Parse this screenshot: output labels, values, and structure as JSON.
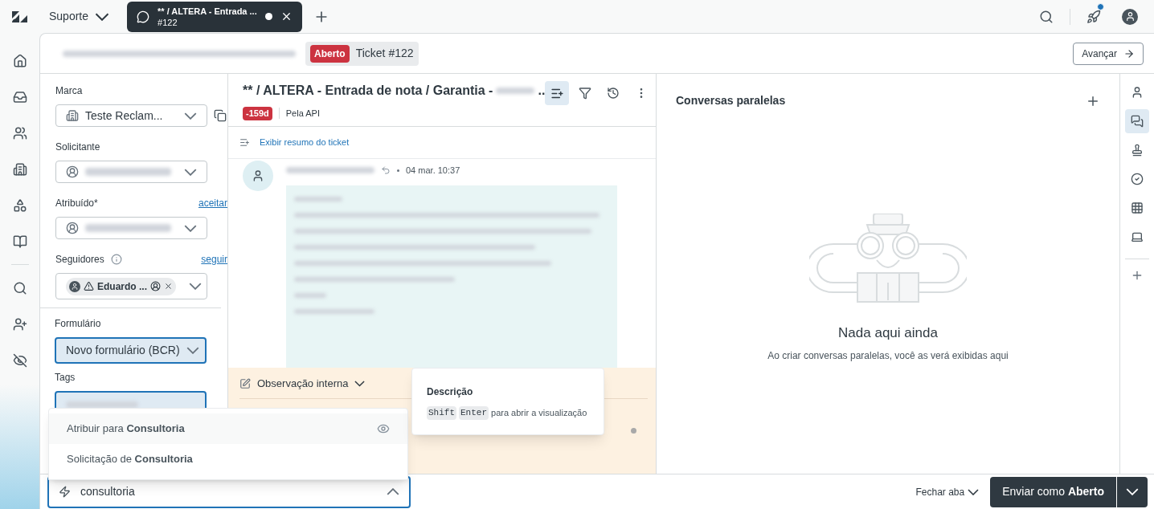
{
  "top_bar": {
    "workspace": "Suporte",
    "tab": {
      "title": "** / ALTERA - Entrada ...",
      "subtitle": "#122",
      "unsaved": true
    },
    "notification": true
  },
  "ticket_header": {
    "status": "Aberto",
    "title": "Ticket #122",
    "next_button": "Avançar"
  },
  "properties": [
    {
      "kind": "select",
      "label": "Marca",
      "value": "Teste Reclam...",
      "focused": false
    },
    {
      "kind": "person",
      "label": "Solicitante",
      "focused": false
    },
    {
      "kind": "person",
      "label": "Atribuído*",
      "link": "aceitar",
      "focused": false
    },
    {
      "kind": "followers",
      "label": "Seguidores",
      "link": "seguir",
      "chip": "Eduardo ...",
      "focused": false
    },
    {
      "kind": "select",
      "label": "Formulário",
      "value": "Novo formulário (BCR)",
      "focused": true
    },
    {
      "kind": "tags",
      "label": "Tags",
      "focused": true
    }
  ],
  "conversation": {
    "title": "** / ALTERA - Entrada de nota / Garantia -",
    "title_end": "..",
    "overdue": "-159d",
    "channel": "Pela API",
    "summary_link": "Exibir resumo do ticket",
    "message_time": "04 mar. 10:37",
    "composer_mode": "Observação interna"
  },
  "macro_menu": {
    "items": [
      {
        "text": "Atribuir para **Consultoria**",
        "selected": true
      },
      {
        "text": "Solicitação de **Consultoria**",
        "selected": false
      }
    ]
  },
  "tooltip": {
    "title": "Descrição",
    "keys": [
      "Shift",
      "Enter"
    ],
    "text": "para abrir a visualização"
  },
  "macro_field": {
    "value": "consultoria"
  },
  "side_panel": {
    "title": "Conversas paralelas",
    "empty_title": "Nada aqui ainda",
    "empty_text": "Ao criar conversas paralelas, você as verá exibidas aqui"
  },
  "rail": [
    {
      "kind": "person",
      "selected": false
    },
    {
      "kind": "chats",
      "selected": true
    },
    {
      "kind": "stamp",
      "selected": false
    },
    {
      "kind": "check",
      "selected": false
    },
    {
      "kind": "apps",
      "selected": false
    },
    {
      "kind": "device",
      "selected": false
    }
  ],
  "footer": {
    "close_tab": "Fechar aba",
    "submit": "Enviar como **Aberto**"
  }
}
